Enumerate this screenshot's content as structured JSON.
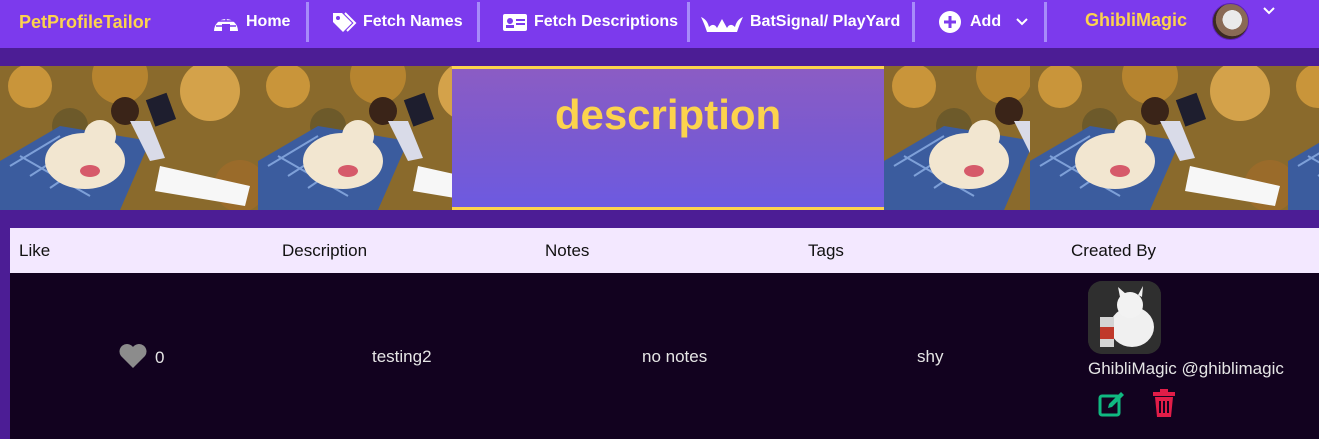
{
  "navbar": {
    "brand": "PetProfileTailor",
    "items": [
      {
        "label": "Home",
        "icon": "igloo-icon"
      },
      {
        "label": "Fetch Names",
        "icon": "tags-icon"
      },
      {
        "label": "Fetch Descriptions",
        "icon": "id-card-icon"
      },
      {
        "label": "BatSignal/ PlayYard",
        "icon": "bat-icon"
      },
      {
        "label": "Add",
        "icon": "plus-circle-icon"
      }
    ],
    "user": {
      "name": "GhibliMagic"
    }
  },
  "banner": {
    "title": "description"
  },
  "table": {
    "headers": [
      "Like",
      "Description",
      "Notes",
      "Tags",
      "Created By"
    ],
    "rows": [
      {
        "likes": "0",
        "description": "testing2",
        "notes": "no notes",
        "tags": "shy",
        "creator_name": "GhibliMagic",
        "creator_handle": "@ghiblimagic"
      }
    ]
  },
  "colors": {
    "nav": "#7c3aed",
    "accent": "#fcd34d",
    "page": "#4c1d95",
    "row": "#12021f",
    "header": "#f3e8ff",
    "edit": "#10b981",
    "delete": "#e11d48"
  }
}
